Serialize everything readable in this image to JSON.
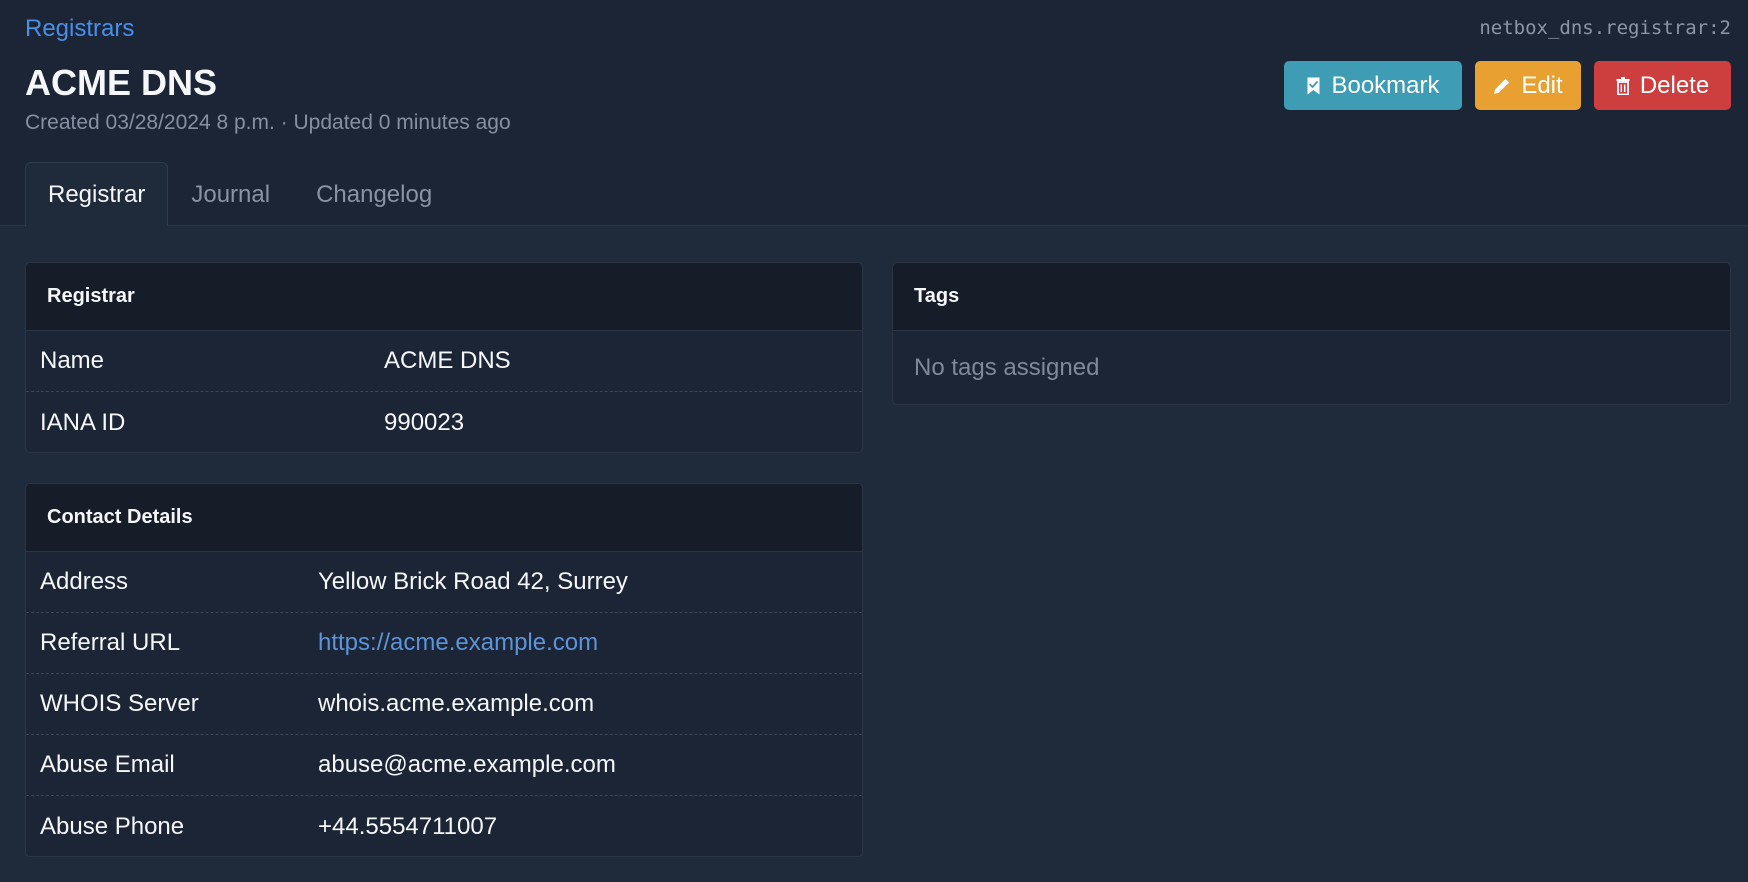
{
  "breadcrumb": {
    "label": "Registrars"
  },
  "object_id": "netbox_dns.registrar:2",
  "title": "ACME DNS",
  "subtitle": "Created 03/28/2024 8 p.m. · Updated 0 minutes ago",
  "actions": {
    "bookmark_label": "Bookmark",
    "edit_label": "Edit",
    "delete_label": "Delete"
  },
  "tabs": [
    {
      "label": "Registrar",
      "active": true
    },
    {
      "label": "Journal",
      "active": false
    },
    {
      "label": "Changelog",
      "active": false
    }
  ],
  "registrar_card": {
    "title": "Registrar",
    "rows": [
      {
        "label": "Name",
        "value": "ACME DNS"
      },
      {
        "label": "IANA ID",
        "value": "990023"
      }
    ]
  },
  "contact_card": {
    "title": "Contact Details",
    "rows": [
      {
        "label": "Address",
        "value": "Yellow Brick Road 42, Surrey"
      },
      {
        "label": "Referral URL",
        "value": "https://acme.example.com"
      },
      {
        "label": "WHOIS Server",
        "value": "whois.acme.example.com"
      },
      {
        "label": "Abuse Email",
        "value": "abuse@acme.example.com"
      },
      {
        "label": "Abuse Phone",
        "value": "+44.5554711007"
      }
    ]
  },
  "tags_card": {
    "title": "Tags",
    "empty_text": "No tags assigned"
  },
  "colors": {
    "background": "#1f2a3b",
    "header_background": "#1c2535",
    "link": "#4a8fe6",
    "bookmark": "#3e9cb4",
    "edit": "#e8a030",
    "delete": "#cd3f3f"
  },
  "icons": {
    "bookmark": "bookmark-icon",
    "edit": "pencil-icon",
    "delete": "trash-icon"
  }
}
